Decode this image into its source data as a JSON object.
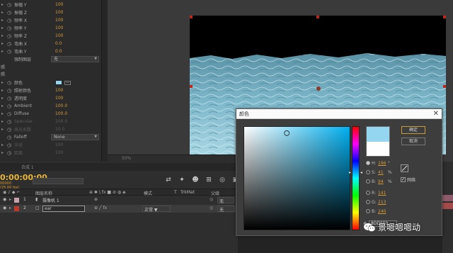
{
  "effect_controls": {
    "props": [
      {
        "label": "振幅 Y",
        "value": "100"
      },
      {
        "label": "振幅 Z",
        "value": "100"
      },
      {
        "label": "频率 X",
        "value": "100"
      },
      {
        "label": "频率 Y",
        "value": "100"
      },
      {
        "label": "频率 Z",
        "value": "100"
      },
      {
        "label": "弯曲 X",
        "value": "0.0"
      },
      {
        "label": "弯曲 Y",
        "value": "0.0"
      }
    ],
    "image_wrap_label": "强制图层",
    "image_wrap_value": "无",
    "section_1": "照",
    "section_2": "照",
    "light_props": [
      {
        "label": "颜色",
        "value": ""
      },
      {
        "label": "照射颜色",
        "value": "100"
      },
      {
        "label": "透明度",
        "value": "100"
      },
      {
        "label": "Ambient",
        "value": "100.0"
      },
      {
        "label": "Diffuse",
        "value": "100.0"
      },
      {
        "label": "Specular",
        "value": "100.0"
      },
      {
        "label": "高光系数",
        "value": "10.0"
      }
    ],
    "falloff_label": "Falloff",
    "falloff_value": "None",
    "dim_props": [
      {
        "label": "半径",
        "value": "100"
      },
      {
        "label": "距离",
        "value": "100"
      }
    ],
    "light_color_hex": "#94d5f0"
  },
  "viewer": {
    "zoom": "50%"
  },
  "timeline": {
    "tab_label": "合成 1",
    "timecode": "0:00:00:00",
    "fps": "00000 (25.00 fps)",
    "columns": {
      "layer_name": "图层名称",
      "mode": "模式",
      "t": "T",
      "trkmat": "TrkMat",
      "parent": "父级"
    },
    "layers": [
      {
        "num": "1",
        "name": "摄像机 1",
        "color": "#c7a3b0",
        "mode": "",
        "parent": "无"
      },
      {
        "num": "2",
        "name": "ear",
        "color": "#c0392b",
        "mode": "正常",
        "parent": "无"
      }
    ]
  },
  "color_dialog": {
    "title": "颜色",
    "ok_label": "确定",
    "cancel_label": "取消",
    "hue_label": "H:",
    "hue_value": "196",
    "hue_unit": "°",
    "sat_label": "S:",
    "sat_value": "41",
    "sat_unit": "%",
    "bri_label": "B:",
    "bri_value": "94",
    "bri_unit": "%",
    "r_label": "R:",
    "r_value": "141",
    "g_label": "G:",
    "g_value": "213",
    "b_label": "B:",
    "b_value": "240",
    "hex_label": "#",
    "hex_value": "8DD5F0",
    "only_web_label": "网络",
    "new_color": "#94d5f0",
    "old_color": "#ffffff"
  },
  "watermark": {
    "text": "景嗯嗯嗯动"
  }
}
